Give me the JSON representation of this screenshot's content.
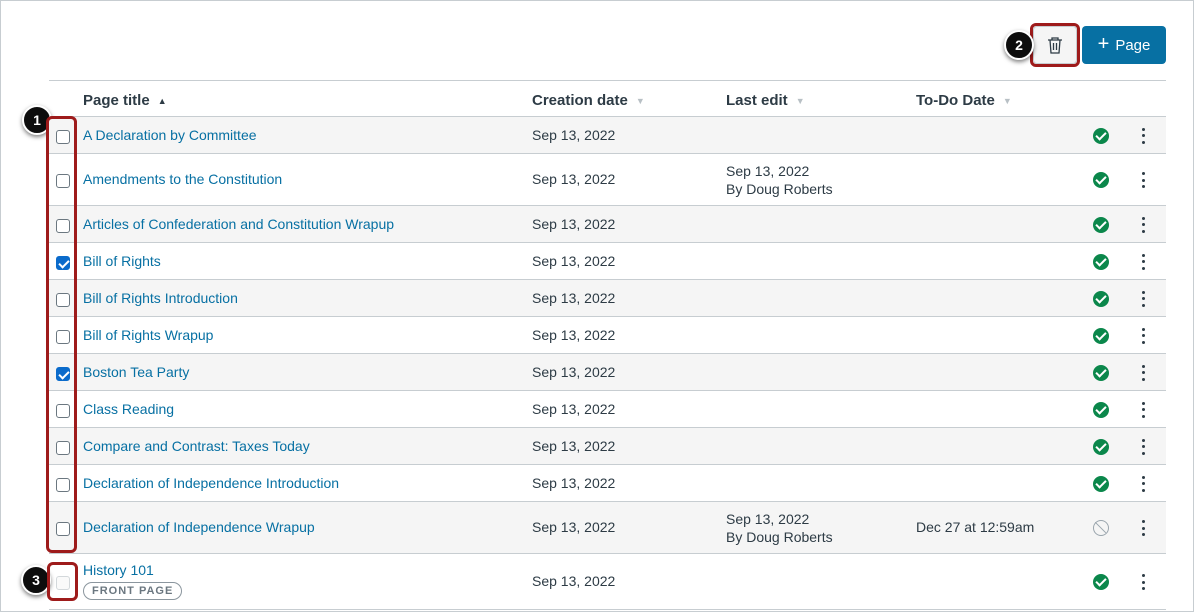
{
  "toolbar": {
    "add_page_label": "Page",
    "add_page_plus": "+"
  },
  "callouts": [
    "1",
    "2",
    "3"
  ],
  "table": {
    "headers": {
      "page_title": "Page title",
      "creation_date": "Creation date",
      "last_edit": "Last edit",
      "todo_date": "To-Do Date"
    },
    "rows": [
      {
        "title": "A Declaration by Committee",
        "created": "Sep 13, 2022",
        "edited": "",
        "edited_by": "",
        "todo": "",
        "checked": false,
        "published": true
      },
      {
        "title": "Amendments to the Constitution",
        "created": "Sep 13, 2022",
        "edited": "Sep 13, 2022",
        "edited_by": "By Doug Roberts",
        "todo": "",
        "checked": false,
        "published": true
      },
      {
        "title": "Articles of Confederation and Constitution Wrapup",
        "created": "Sep 13, 2022",
        "edited": "",
        "edited_by": "",
        "todo": "",
        "checked": false,
        "published": true
      },
      {
        "title": "Bill of Rights",
        "created": "Sep 13, 2022",
        "edited": "",
        "edited_by": "",
        "todo": "",
        "checked": true,
        "published": true
      },
      {
        "title": "Bill of Rights Introduction",
        "created": "Sep 13, 2022",
        "edited": "",
        "edited_by": "",
        "todo": "",
        "checked": false,
        "published": true
      },
      {
        "title": "Bill of Rights Wrapup",
        "created": "Sep 13, 2022",
        "edited": "",
        "edited_by": "",
        "todo": "",
        "checked": false,
        "published": true
      },
      {
        "title": "Boston Tea Party",
        "created": "Sep 13, 2022",
        "edited": "",
        "edited_by": "",
        "todo": "",
        "checked": true,
        "published": true
      },
      {
        "title": "Class Reading",
        "created": "Sep 13, 2022",
        "edited": "",
        "edited_by": "",
        "todo": "",
        "checked": false,
        "published": true
      },
      {
        "title": "Compare and Contrast: Taxes Today",
        "created": "Sep 13, 2022",
        "edited": "",
        "edited_by": "",
        "todo": "",
        "checked": false,
        "published": true
      },
      {
        "title": "Declaration of Independence Introduction",
        "created": "Sep 13, 2022",
        "edited": "",
        "edited_by": "",
        "todo": "",
        "checked": false,
        "published": true
      },
      {
        "title": "Declaration of Independence Wrapup",
        "created": "Sep 13, 2022",
        "edited": "Sep 13, 2022",
        "edited_by": "By Doug Roberts",
        "todo": "Dec 27 at 12:59am",
        "checked": false,
        "published": false
      },
      {
        "title": "History 101",
        "created": "Sep 13, 2022",
        "edited": "",
        "edited_by": "",
        "todo": "",
        "checked": false,
        "published": true,
        "badge": "FRONT PAGE",
        "disabled": true
      }
    ]
  },
  "colors": {
    "link": "#0770a3",
    "primary_button": "#0770a3",
    "published": "#0b874b",
    "callout_ring": "#9e1b1b",
    "checkbox_checked": "#0b6bcb"
  },
  "icons": {
    "delete": "trash-icon",
    "published": "published-check-icon",
    "unpublished": "unpublished-icon",
    "menu": "kebab-menu-icon",
    "sort": "sort-arrow-icon"
  }
}
